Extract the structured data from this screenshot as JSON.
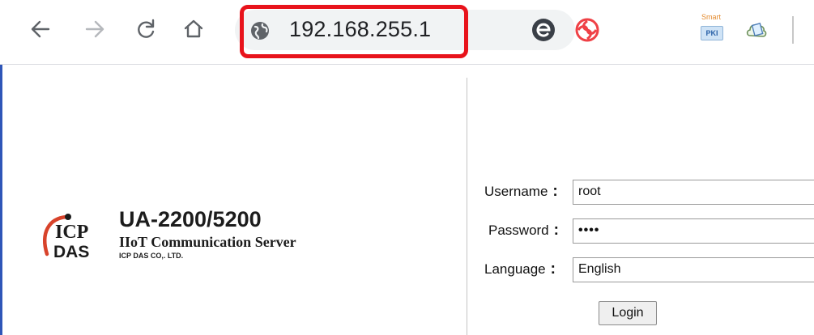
{
  "browser": {
    "url": "192.168.255.1",
    "icons": {
      "back": "back-arrow-icon",
      "forward": "forward-arrow-icon",
      "reload": "reload-icon",
      "home": "home-icon",
      "site_info": "globe-icon"
    },
    "extensions": [
      {
        "name": "e-extension-icon"
      },
      {
        "name": "swirl-extension-icon"
      },
      {
        "name": "smart-pki-extension-icon",
        "label_top": "Smart",
        "label_box": "PKI"
      },
      {
        "name": "cloud-extension-icon"
      }
    ],
    "highlight_color": "#e8131b"
  },
  "brand": {
    "logo_letters_top": "ICP",
    "logo_letters_bottom": "DAS",
    "product_name": "UA-2200/5200",
    "product_description": "IIoT Communication Server",
    "company": "ICP DAS CO,. LTD."
  },
  "login_form": {
    "username_label": "Username",
    "username_value": "root",
    "password_label": "Password",
    "password_value": "••••",
    "language_label": "Language",
    "language_value": "English",
    "colon": ":",
    "login_button": "Login"
  },
  "colors": {
    "accent_blue": "#2f56b8",
    "logo_red": "#d8432b"
  }
}
